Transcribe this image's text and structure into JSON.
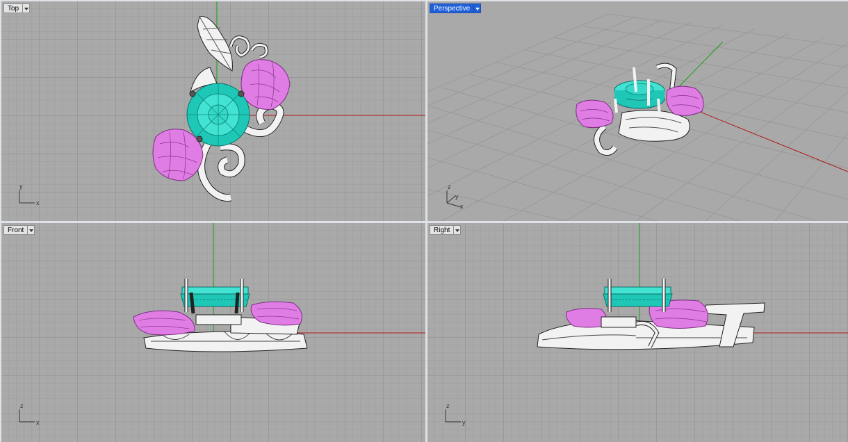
{
  "viewports": {
    "top": {
      "label": "Top",
      "axis_a": "y",
      "axis_b": "x"
    },
    "perspective": {
      "label": "Perspective",
      "axis_z": "z",
      "axis_a": "y",
      "axis_b": "x"
    },
    "front": {
      "label": "Front",
      "axis_a": "z",
      "axis_b": "x"
    },
    "right": {
      "label": "Right",
      "axis_a": "z",
      "axis_b": "y"
    }
  },
  "colors": {
    "gem": "#30d6c4",
    "rose": "#e07de4",
    "metal": "#f2f2f2",
    "x_axis": "#b01818",
    "y_axis": "#12a012",
    "grid_bg": "#a9a9a9",
    "grid_minor": "#9d9d9d",
    "grid_major": "#8c8c8c",
    "active_label": "#1f5fd8"
  }
}
